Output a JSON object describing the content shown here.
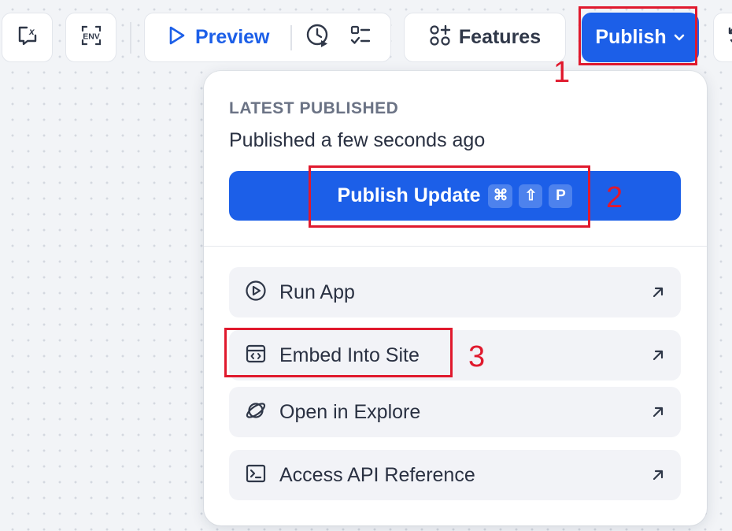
{
  "toolbar": {
    "preview_label": "Preview",
    "features_label": "Features",
    "publish_label": "Publish",
    "env_label": "ENV",
    "variable_icon_label": "x"
  },
  "publish_menu": {
    "heading": "LATEST PUBLISHED",
    "status": "Published a few seconds ago",
    "update_button": {
      "label": "Publish Update",
      "shortcut": [
        "⌘",
        "⇧",
        "P"
      ]
    },
    "actions": [
      {
        "label": "Run App",
        "icon": "play-circle-icon"
      },
      {
        "label": "Embed Into Site",
        "icon": "embed-icon"
      },
      {
        "label": "Open in Explore",
        "icon": "explore-icon"
      },
      {
        "label": "Access API Reference",
        "icon": "terminal-icon"
      }
    ]
  },
  "annotations": [
    "1",
    "2",
    "3"
  ],
  "colors": {
    "accent": "#1c5fe8",
    "annotation": "#e0192d",
    "background": "#f2f4f7",
    "action_bg": "#f2f3f7"
  }
}
